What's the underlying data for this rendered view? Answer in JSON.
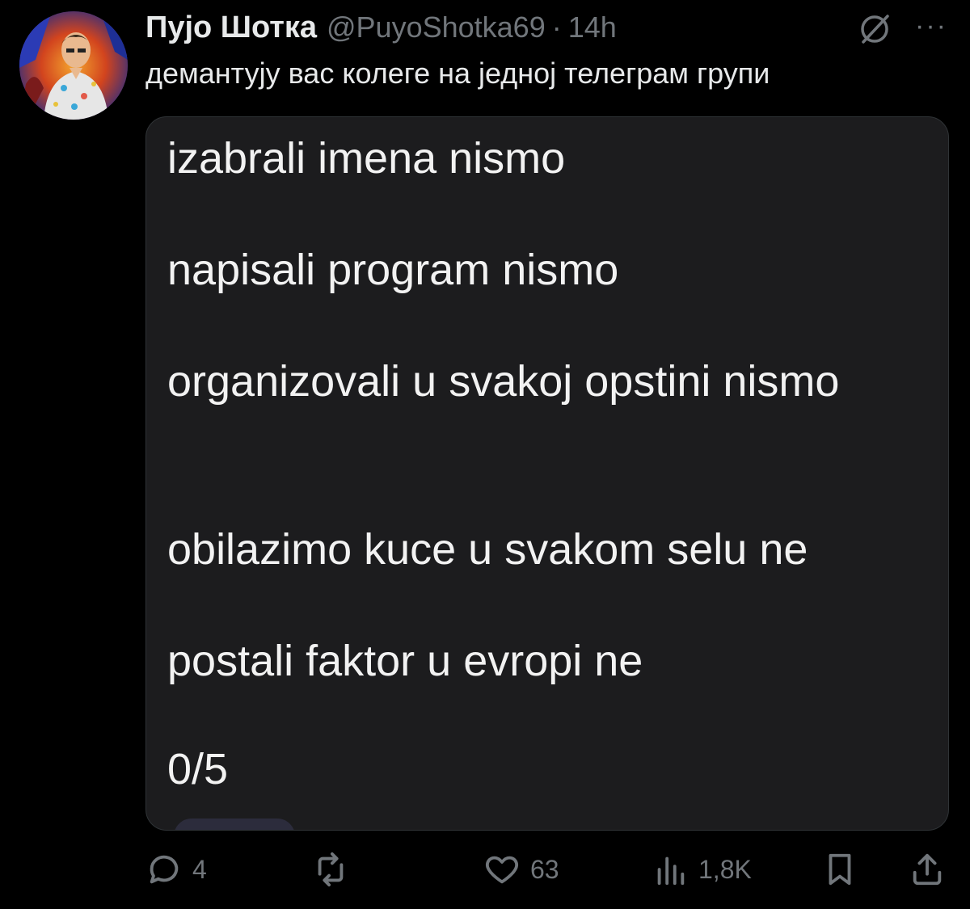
{
  "tweet": {
    "author_name": "Пујо Шотка",
    "handle": "@PuyoShotka69",
    "separator": "·",
    "time": "14h",
    "text": "демантују вас колеге на једној телеграм групи",
    "more_label": "···"
  },
  "image_note": {
    "lines": [
      "izabrali imena nismo",
      "napisali program nismo",
      "organizovali u svakoj opstini nismo",
      "obilazimo kuce u svakom selu ne",
      "postali faktor u evropi ne",
      "0/5"
    ]
  },
  "actions": {
    "replies": "4",
    "reposts": "",
    "likes": "63",
    "views": "1,8K"
  },
  "colors": {
    "background": "#000000",
    "text": "#e7e9ea",
    "muted": "#71767b",
    "card": "#1c1c1e"
  }
}
